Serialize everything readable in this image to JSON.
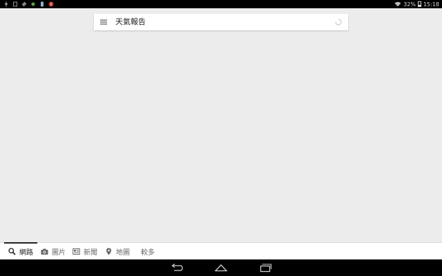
{
  "status_bar": {
    "battery_percent": "32%",
    "time": "15:18",
    "left_icons": [
      "usb-icon",
      "notification-icon",
      "clip-icon",
      "app-icon",
      "phone-icon",
      "alert-icon"
    ],
    "right_icons": [
      "wifi-icon",
      "battery-icon"
    ]
  },
  "search": {
    "query": "天氣報告"
  },
  "tabs": [
    {
      "label": "網路",
      "icon": "search-icon",
      "active": true
    },
    {
      "label": "圖片",
      "icon": "camera-icon",
      "active": false
    },
    {
      "label": "新聞",
      "icon": "news-icon",
      "active": false
    },
    {
      "label": "地圖",
      "icon": "map-pin-icon",
      "active": false
    },
    {
      "label": "較多",
      "icon": "",
      "active": false
    }
  ],
  "nav_bar": {
    "buttons": [
      "back-icon",
      "home-icon",
      "recent-apps-icon"
    ]
  },
  "colors": {
    "background": "#ececec",
    "status_bar": "#000000",
    "nav_bar": "#000000",
    "search_box": "#ffffff",
    "active_tab_underline": "#222222"
  }
}
